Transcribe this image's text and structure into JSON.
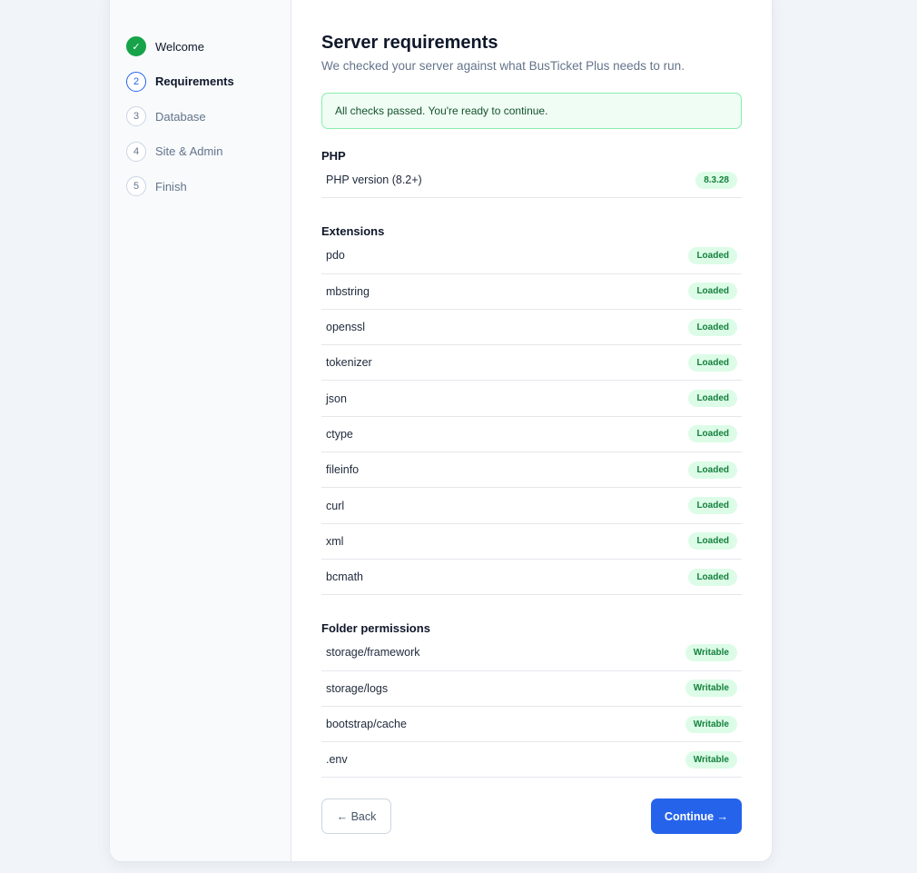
{
  "steps": [
    {
      "number": "✓",
      "label": "Welcome",
      "state": "done"
    },
    {
      "number": "2",
      "label": "Requirements",
      "state": "active"
    },
    {
      "number": "3",
      "label": "Database",
      "state": "pending"
    },
    {
      "number": "4",
      "label": "Site & Admin",
      "state": "pending"
    },
    {
      "number": "5",
      "label": "Finish",
      "state": "pending"
    }
  ],
  "main": {
    "title": "Server requirements",
    "subtitle": "We checked your server against what BusTicket Plus needs to run.",
    "alert": "All checks passed. You're ready to continue."
  },
  "php": {
    "title": "PHP",
    "rows": [
      {
        "label": "PHP version (8.2+)",
        "status": "8.3.28"
      }
    ]
  },
  "extensions": {
    "title": "Extensions",
    "rows": [
      {
        "label": "pdo",
        "status": "Loaded"
      },
      {
        "label": "mbstring",
        "status": "Loaded"
      },
      {
        "label": "openssl",
        "status": "Loaded"
      },
      {
        "label": "tokenizer",
        "status": "Loaded"
      },
      {
        "label": "json",
        "status": "Loaded"
      },
      {
        "label": "ctype",
        "status": "Loaded"
      },
      {
        "label": "fileinfo",
        "status": "Loaded"
      },
      {
        "label": "curl",
        "status": "Loaded"
      },
      {
        "label": "xml",
        "status": "Loaded"
      },
      {
        "label": "bcmath",
        "status": "Loaded"
      }
    ]
  },
  "folders": {
    "title": "Folder permissions",
    "rows": [
      {
        "label": "storage/framework",
        "status": "Writable"
      },
      {
        "label": "storage/logs",
        "status": "Writable"
      },
      {
        "label": "bootstrap/cache",
        "status": "Writable"
      },
      {
        "label": ".env",
        "status": "Writable"
      }
    ]
  },
  "buttons": {
    "back": "← Back",
    "continue": "Continue →"
  },
  "colors": {
    "accent": "#2563eb",
    "success": "#16a34a",
    "badge_bg": "#dcfce7",
    "badge_text": "#15803d"
  }
}
